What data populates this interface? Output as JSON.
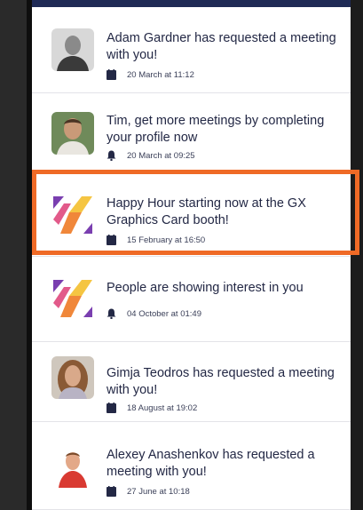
{
  "notifications": [
    {
      "text": "Adam Gardner has requested a meeting with you!",
      "date": "20 March at 11:12",
      "icon": "calendar-icon",
      "avatar": "person-avatar"
    },
    {
      "text": "Tim, get more meetings by completing your profile now",
      "date": "20 March at 09:25",
      "icon": "bell-icon",
      "avatar": "person-avatar"
    },
    {
      "text": "Happy Hour starting now at the GX Graphics Card booth!",
      "date": "15 February at 16:50",
      "icon": "calendar-icon",
      "avatar": "event-logo"
    },
    {
      "text": "People are showing interest in you",
      "date": "04 October at 01:49",
      "icon": "bell-icon",
      "avatar": "event-logo"
    },
    {
      "text": "Gimja Teodros has requested a meeting with you!",
      "date": "18 August at 19:02",
      "icon": "calendar-icon",
      "avatar": "person-avatar"
    },
    {
      "text": "Alexey Anashenkov has requested a meeting with you!",
      "date": "27 June at 10:18",
      "icon": "calendar-icon",
      "avatar": "person-avatar"
    }
  ],
  "colors": {
    "highlight": "#ef6a26",
    "text": "#232845",
    "header": "#1f2a55",
    "logo_orange": "#f0873a",
    "logo_purple": "#7a3fb0",
    "logo_yellow": "#f5c542"
  }
}
